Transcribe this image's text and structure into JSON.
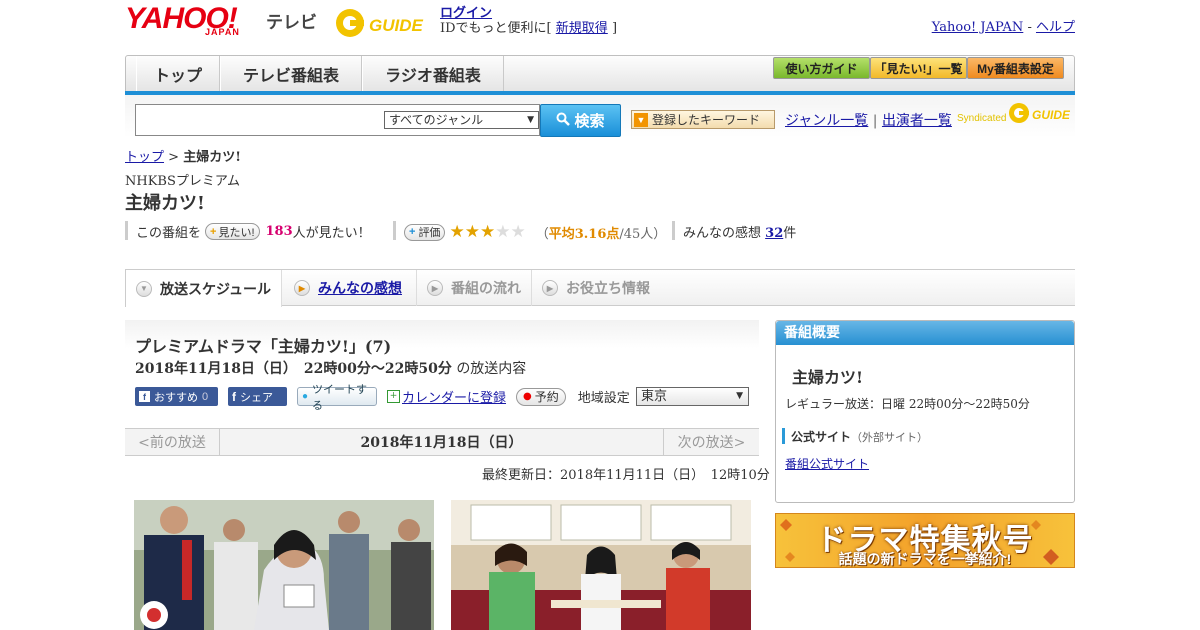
{
  "header": {
    "logo_main": "YAHOO!",
    "logo_sub": "JAPAN",
    "service": "テレビ",
    "guide_logo": "G GUIDE",
    "login_link": "ログイン",
    "login_text": "IDでもっと便利に[",
    "signup_link": "新規取得",
    "login_close": "]",
    "yahoo_link": "Yahoo! JAPAN",
    "dash": " - ",
    "help_link": "ヘルプ"
  },
  "nav": {
    "tabs": [
      "トップ",
      "テレビ番組表",
      "ラジオ番組表"
    ],
    "right_buttons": [
      {
        "label": "使い方ガイド",
        "color": "#8cc63f"
      },
      {
        "label": "「見たい!」一覧",
        "color": "#f6c12e"
      },
      {
        "label": "My番組表設定",
        "color": "#f39a2b"
      }
    ]
  },
  "search": {
    "input_value": "",
    "genre_selected": "すべてのジャンル",
    "search_button": "検索",
    "keyword_button": "登録したキーワード",
    "genre_list_link": "ジャンル一覧",
    "divider": "|",
    "performer_link": "出演者一覧",
    "syndicated": "Syndicated"
  },
  "breadcrumb": {
    "top": "トップ",
    "sep": " > ",
    "current": "主婦カツ!"
  },
  "program": {
    "channel": "NHKBSプレミアム",
    "title": "主婦カツ!",
    "want_prefix": "この番組を",
    "want_button": "見たい!",
    "want_count": "183",
    "want_suffix": "人が見たい！",
    "rate_button": "評価",
    "rating": 3.16,
    "rating_open": "（",
    "rating_avg": "平均3.16点",
    "rating_people": "/45人）",
    "reviews_prefix": "みんなの感想",
    "reviews_count": "32",
    "reviews_suffix": "件"
  },
  "tabs": [
    "放送スケジュール",
    "みんなの感想",
    "番組の流れ",
    "お役立ち情報"
  ],
  "episode": {
    "title": "プレミアムドラマ「主婦カツ!」(7)",
    "date": "2018年11月18日（日）　22時00分～22時50分",
    "date_suffix": "の放送内容",
    "recommend_label": "おすすめ",
    "recommend_count": "0",
    "share_label": "シェア",
    "tweet_label": "ツイートする",
    "calendar_label": "カレンダーに登録",
    "reserve_label": "予約",
    "region_label": "地域設定",
    "region_value": "東京",
    "prev": "<前の放送",
    "pager_date": "2018年11月18日（日）",
    "next": "次の放送>",
    "updated": "最終更新日：2018年11月11日（日）　12時10分"
  },
  "sidebar": {
    "header": "番組概要",
    "title": "主婦カツ!",
    "regular": "レギュラー放送：日曜 22時00分～22時50分",
    "official_label": "公式サイト",
    "official_note": "（外部サイト）",
    "official_link": "番組公式サイト"
  },
  "promo": {
    "line1": "ドラマ特集秋号",
    "line2": "話題の新ドラマを一挙紹介!"
  },
  "colors": {
    "accent": "#1e8fd6",
    "link": "#1a1aa6",
    "pink": "#d6006f",
    "orange": "#e08a00"
  }
}
